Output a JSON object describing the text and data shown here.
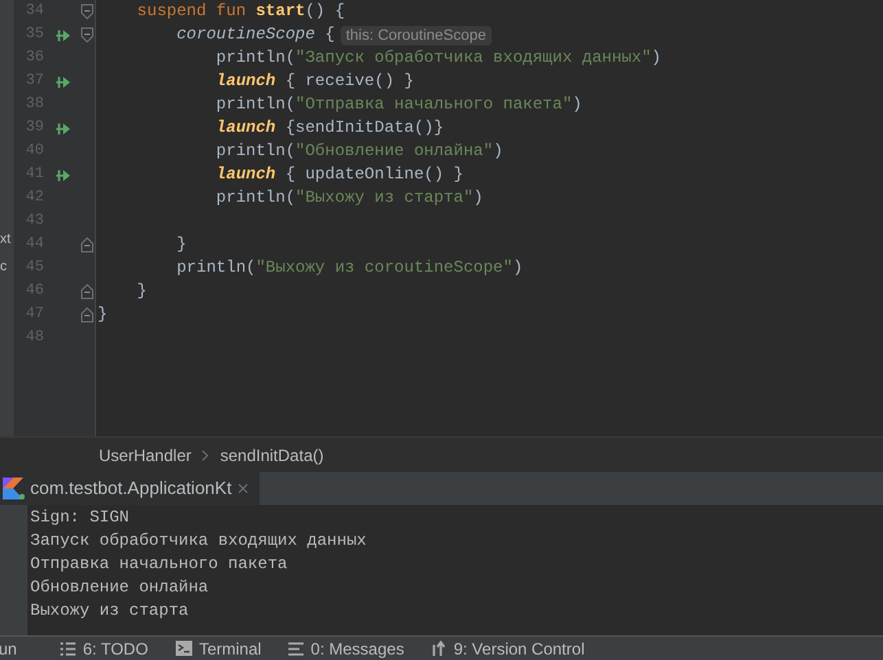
{
  "project_tree_fragments": [
    "xt",
    "c"
  ],
  "editor": {
    "lines": [
      {
        "number": "34",
        "run_marker": false,
        "fold_start": true,
        "fold_end": false,
        "tokens": [
          {
            "kind": "keyword",
            "text": "    suspend fun "
          },
          {
            "kind": "declaration",
            "text": "start"
          },
          {
            "kind": "plain",
            "text": "() {"
          }
        ]
      },
      {
        "number": "35",
        "run_marker": true,
        "fold_start": true,
        "fold_end": false,
        "tokens": [
          {
            "kind": "scope",
            "text": "        coroutineScope"
          },
          {
            "kind": "plain",
            "text": " {"
          }
        ],
        "hint": "this: CoroutineScope"
      },
      {
        "number": "36",
        "run_marker": false,
        "fold_start": false,
        "fold_end": false,
        "tokens": [
          {
            "kind": "plain",
            "text": "            println("
          },
          {
            "kind": "string",
            "text": "\"Запуск обработчика входящих данных\""
          },
          {
            "kind": "plain",
            "text": ")"
          }
        ]
      },
      {
        "number": "37",
        "run_marker": true,
        "fold_start": false,
        "fold_end": false,
        "tokens": [
          {
            "kind": "launch",
            "text": "            launch"
          },
          {
            "kind": "plain",
            "text": " { receive() }"
          }
        ]
      },
      {
        "number": "38",
        "run_marker": false,
        "fold_start": false,
        "fold_end": false,
        "tokens": [
          {
            "kind": "plain",
            "text": "            println("
          },
          {
            "kind": "string",
            "text": "\"Отправка начального пакета\""
          },
          {
            "kind": "plain",
            "text": ")"
          }
        ]
      },
      {
        "number": "39",
        "run_marker": true,
        "fold_start": false,
        "fold_end": false,
        "tokens": [
          {
            "kind": "launch",
            "text": "            launch"
          },
          {
            "kind": "plain",
            "text": " {sendInitData()}"
          }
        ]
      },
      {
        "number": "40",
        "run_marker": false,
        "fold_start": false,
        "fold_end": false,
        "tokens": [
          {
            "kind": "plain",
            "text": "            println("
          },
          {
            "kind": "string",
            "text": "\"Обновление онлайна\""
          },
          {
            "kind": "plain",
            "text": ")"
          }
        ]
      },
      {
        "number": "41",
        "run_marker": true,
        "fold_start": false,
        "fold_end": false,
        "tokens": [
          {
            "kind": "launch",
            "text": "            launch"
          },
          {
            "kind": "plain",
            "text": " { updateOnline() }"
          }
        ]
      },
      {
        "number": "42",
        "run_marker": false,
        "fold_start": false,
        "fold_end": false,
        "tokens": [
          {
            "kind": "plain",
            "text": "            println("
          },
          {
            "kind": "string",
            "text": "\"Выхожу из старта\""
          },
          {
            "kind": "plain",
            "text": ")"
          }
        ]
      },
      {
        "number": "43",
        "run_marker": false,
        "fold_start": false,
        "fold_end": false
      },
      {
        "number": "44",
        "run_marker": false,
        "fold_start": false,
        "fold_end": true,
        "tokens": [
          {
            "kind": "plain",
            "text": "        }"
          }
        ]
      },
      {
        "number": "45",
        "run_marker": false,
        "fold_start": false,
        "fold_end": false,
        "tokens": [
          {
            "kind": "plain",
            "text": "        println("
          },
          {
            "kind": "string",
            "text": "\"Выхожу из coroutineScope\""
          },
          {
            "kind": "plain",
            "text": ")"
          }
        ]
      },
      {
        "number": "46",
        "run_marker": false,
        "fold_start": false,
        "fold_end": true,
        "tokens": [
          {
            "kind": "plain",
            "text": "    }"
          }
        ]
      },
      {
        "number": "47",
        "run_marker": false,
        "fold_start": false,
        "fold_end": true,
        "tokens": [
          {
            "kind": "plain",
            "text": "}"
          }
        ]
      },
      {
        "number": "48",
        "run_marker": false,
        "fold_start": false,
        "fold_end": false
      }
    ]
  },
  "breadcrumbs": [
    "UserHandler",
    "sendInitData()"
  ],
  "run_panel": {
    "tab": {
      "label": "com.testbot.ApplicationKt",
      "selected": true
    },
    "console": [
      "Sign: SIGN",
      "Запуск обработчика входящих данных",
      "Отправка начального пакета",
      "Обновление онлайна",
      "Выхожу из старта"
    ]
  },
  "tool_windows": [
    {
      "kind": "run",
      "label": "un"
    },
    {
      "kind": "todo",
      "label": "6: TODO"
    },
    {
      "kind": "terminal",
      "label": "Terminal"
    },
    {
      "kind": "messages",
      "label": "0: Messages"
    },
    {
      "kind": "vcs",
      "label": "9: Version Control"
    }
  ]
}
